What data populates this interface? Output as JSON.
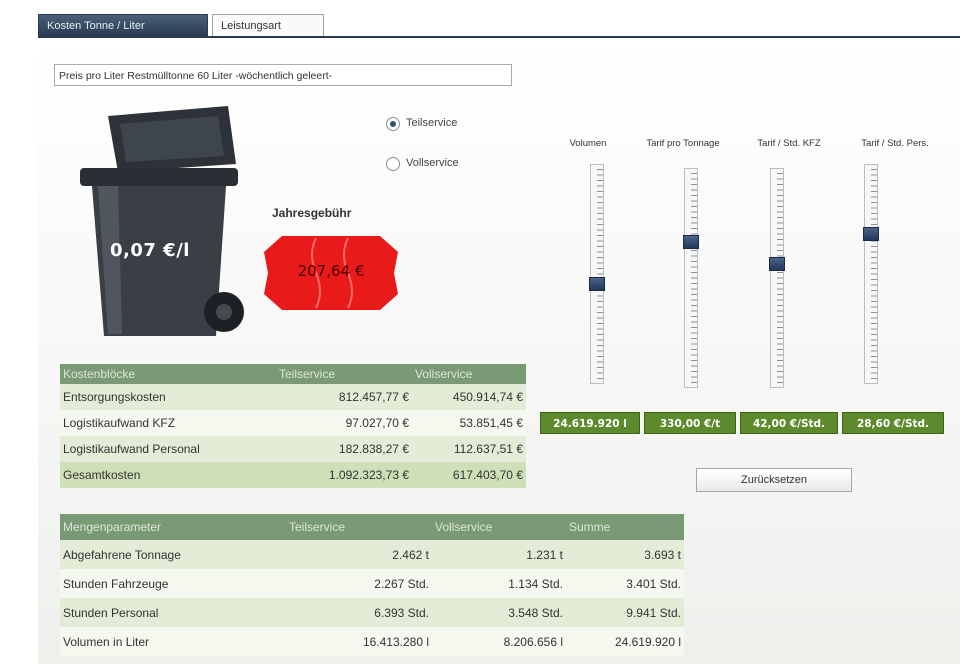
{
  "tabs": [
    {
      "label": "Kosten Tonne / Liter",
      "active": true
    },
    {
      "label": "Leistungsart",
      "active": false
    }
  ],
  "price_field": {
    "value": "Preis pro Liter Restmülltonne 60 Liter  -wöchentlich geleert-"
  },
  "bin": {
    "price_label": "0,07 €/l",
    "color": "#3a3f46"
  },
  "service": {
    "options": [
      {
        "label": "Teilservice",
        "checked": true
      },
      {
        "label": "Vollservice",
        "checked": false
      }
    ]
  },
  "fee": {
    "label": "Jahresgebühr",
    "value": "207,64 €",
    "tag_color": "#e81a1a"
  },
  "sliders": [
    {
      "label": "Volumen",
      "value_text": "24.619.920 l",
      "level": 0.55
    },
    {
      "label": "Tarif pro Tonnage",
      "value_text": "330,00 €/t",
      "level": 0.32
    },
    {
      "label": "Tarif / Std. KFZ",
      "value_text": "42,00 €/Std.",
      "level": 0.43
    },
    {
      "label": "Tarif / Std. Pers.",
      "value_text": "28,60 €/Std.",
      "level": 0.3
    }
  ],
  "reset_button": {
    "label": "Zurücksetzen"
  },
  "cost_table": {
    "headers": [
      "Kostenblöcke",
      "Teilservice",
      "Vollservice"
    ],
    "rows": [
      [
        "Entsorgungskosten",
        "812.457,77 €",
        "450.914,74 €"
      ],
      [
        "Logistikaufwand KFZ",
        "97.027,70 €",
        "53.851,45 €"
      ],
      [
        "Logistikaufwand Personal",
        "182.838,27 €",
        "112.637,51 €"
      ],
      [
        "Gesamtkosten",
        "1.092.323,73 €",
        "617.403,70 €"
      ]
    ]
  },
  "quantity_table": {
    "headers": [
      "Mengenparameter",
      "Teilservice",
      "Vollservice",
      "Summe"
    ],
    "rows": [
      [
        "Abgefahrene Tonnage",
        "2.462 t",
        "1.231 t",
        "3.693 t"
      ],
      [
        "Stunden Fahrzeuge",
        "2.267 Std.",
        "1.134 Std.",
        "3.401 Std."
      ],
      [
        "Stunden Personal",
        "6.393 Std.",
        "3.548 Std.",
        "9.941 Std."
      ],
      [
        "Volumen in Liter",
        "16.413.280 l",
        "8.206.656 l",
        "24.619.920 l"
      ]
    ]
  },
  "colors": {
    "header_dark": "#2a3a4f",
    "value_box": "#5d8a2c",
    "table_header": "#7a9a76"
  }
}
